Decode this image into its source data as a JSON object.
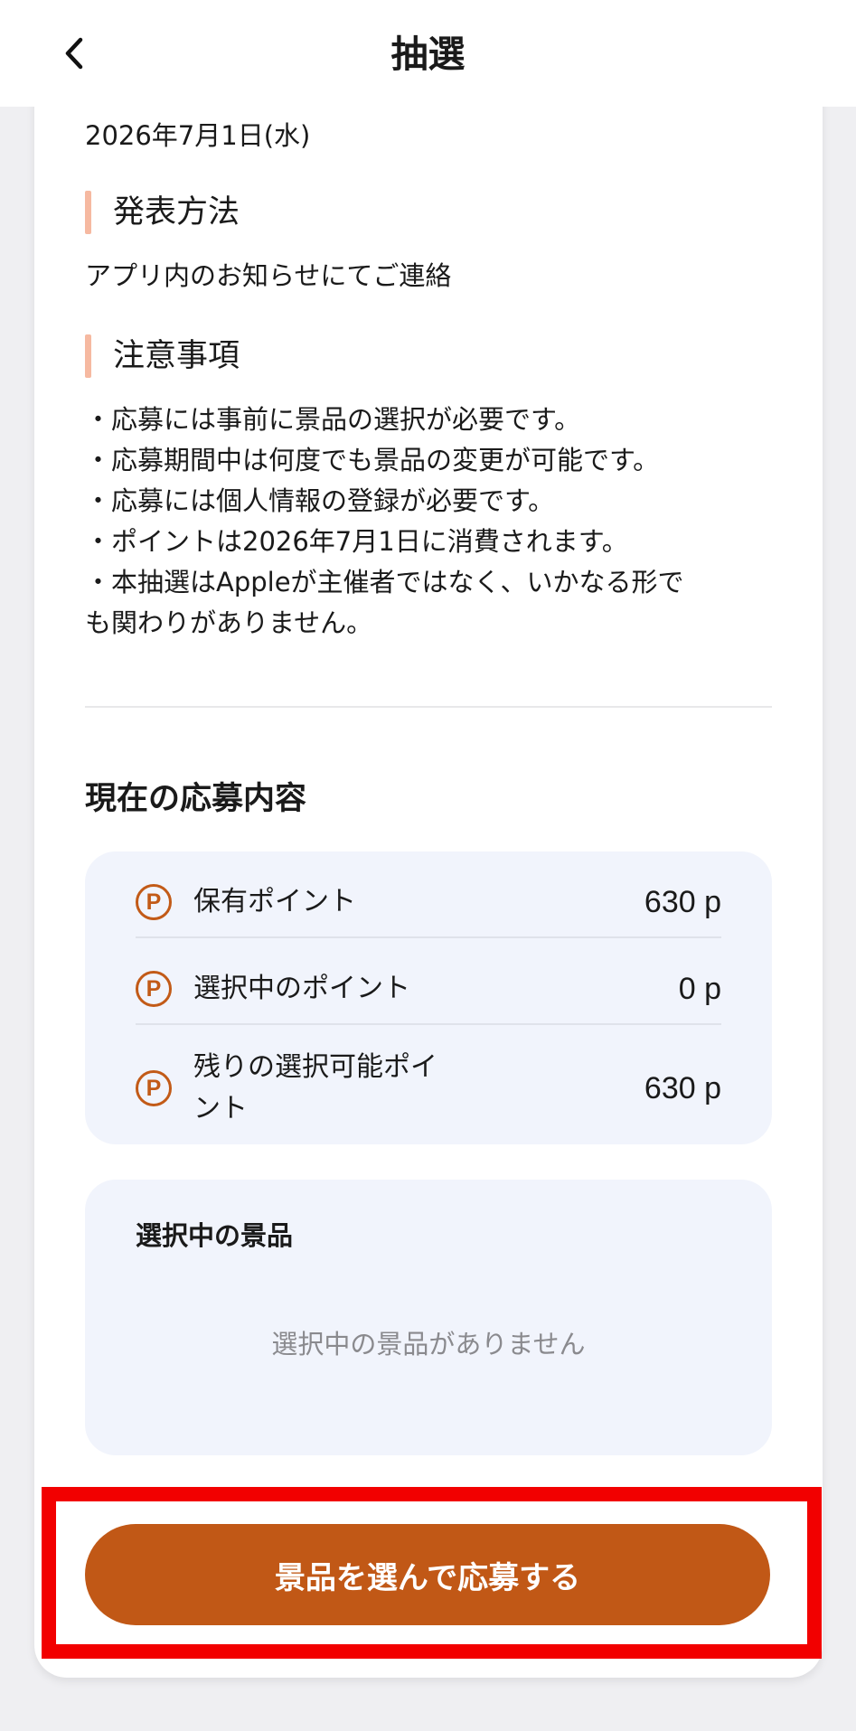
{
  "header": {
    "title": "抽選",
    "back_icon": "chevron-left-icon"
  },
  "details": {
    "date": "2026年7月1日(水)",
    "announcement_heading": "発表方法",
    "announcement_text": "アプリ内のお知らせにてご連絡",
    "notes_heading": "注意事項",
    "notes": [
      "・応募には事前に景品の選択が必要です。",
      "・応募期間中は何度でも景品の変更が可能です。",
      "・応募には個人情報の登録が必要です。",
      "・ポイントは2026年7月1日に消費されます。",
      "・本抽選はAppleが主催者ではなく、いかなる形で",
      "も関わりがありません。"
    ]
  },
  "current": {
    "title": "現在の応募内容",
    "point_icon": "P",
    "rows": [
      {
        "label": "保有ポイント",
        "value": "630 p"
      },
      {
        "label": "選択中のポイント",
        "value": "0 p"
      },
      {
        "label_line1": "残りの選択可能ポイ",
        "label_line2": "ント",
        "value": "630 p"
      }
    ]
  },
  "prize": {
    "title": "選択中の景品",
    "empty_text": "選択中の景品がありません"
  },
  "cta": {
    "label": "景品を選んで応募する"
  },
  "colors": {
    "accent": "#c15816",
    "section_bar": "#f6b9a1",
    "panel_bg": "#f1f4fc",
    "highlight": "#f20000"
  }
}
